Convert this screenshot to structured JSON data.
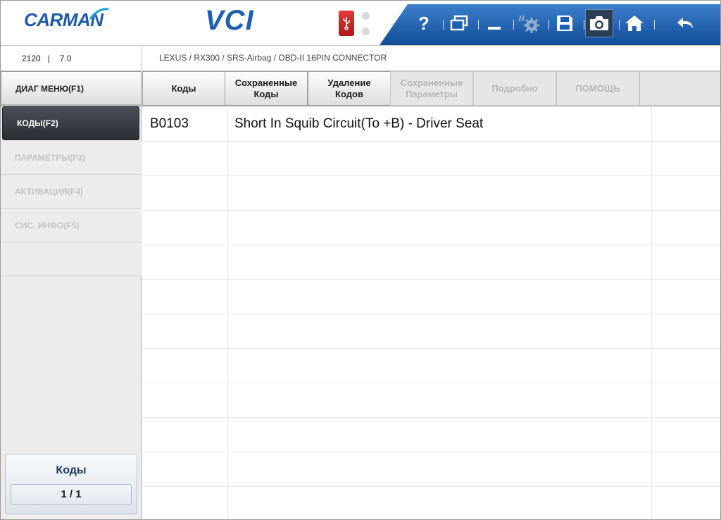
{
  "header": {
    "logo_text": "CARMAN",
    "product": "VCI",
    "colors": {
      "brand_blue": "#1d5aa8",
      "toolbar_blue": "#1a5fb2",
      "usb_red": "#d42626"
    },
    "toolbar_icons": [
      "help-icon",
      "windows-icon",
      "minimize-icon",
      "settings-icon",
      "save-icon",
      "camera-icon",
      "home-icon",
      "back-icon"
    ],
    "help_label": "?"
  },
  "infobar": {
    "version_left": "2120",
    "version_sep": "|",
    "version_right": "7.0",
    "path": "LEXUS / RX300 / SRS-Airbag / OBD-II 16PIN CONNECTOR"
  },
  "sidebar": {
    "items": [
      {
        "label": "ДИАГ МЕНЮ(F1)"
      },
      {
        "label": "КОДЫ(F2)"
      },
      {
        "label": "ПАРАМЕТРЫ(F3)"
      },
      {
        "label": "АКТИВАЦИЯ(F4)"
      },
      {
        "label": "СИС. ИНФО(F5)"
      }
    ],
    "counter": {
      "title": "Коды",
      "value": "1 / 1"
    }
  },
  "tabs": [
    {
      "line1": "Коды",
      "line2": ""
    },
    {
      "line1": "Сохраненные",
      "line2": "Коды"
    },
    {
      "line1": "Удаление",
      "line2": "Кодов"
    },
    {
      "line1": "Сохраненные",
      "line2": "Параметры"
    },
    {
      "line1": "Подробно",
      "line2": ""
    },
    {
      "line1": "ПОМОЩЬ",
      "line2": ""
    }
  ],
  "codes": {
    "rows": [
      {
        "code": "B0103",
        "description": "Short In Squib Circuit(To +B) - Driver Seat"
      }
    ]
  }
}
